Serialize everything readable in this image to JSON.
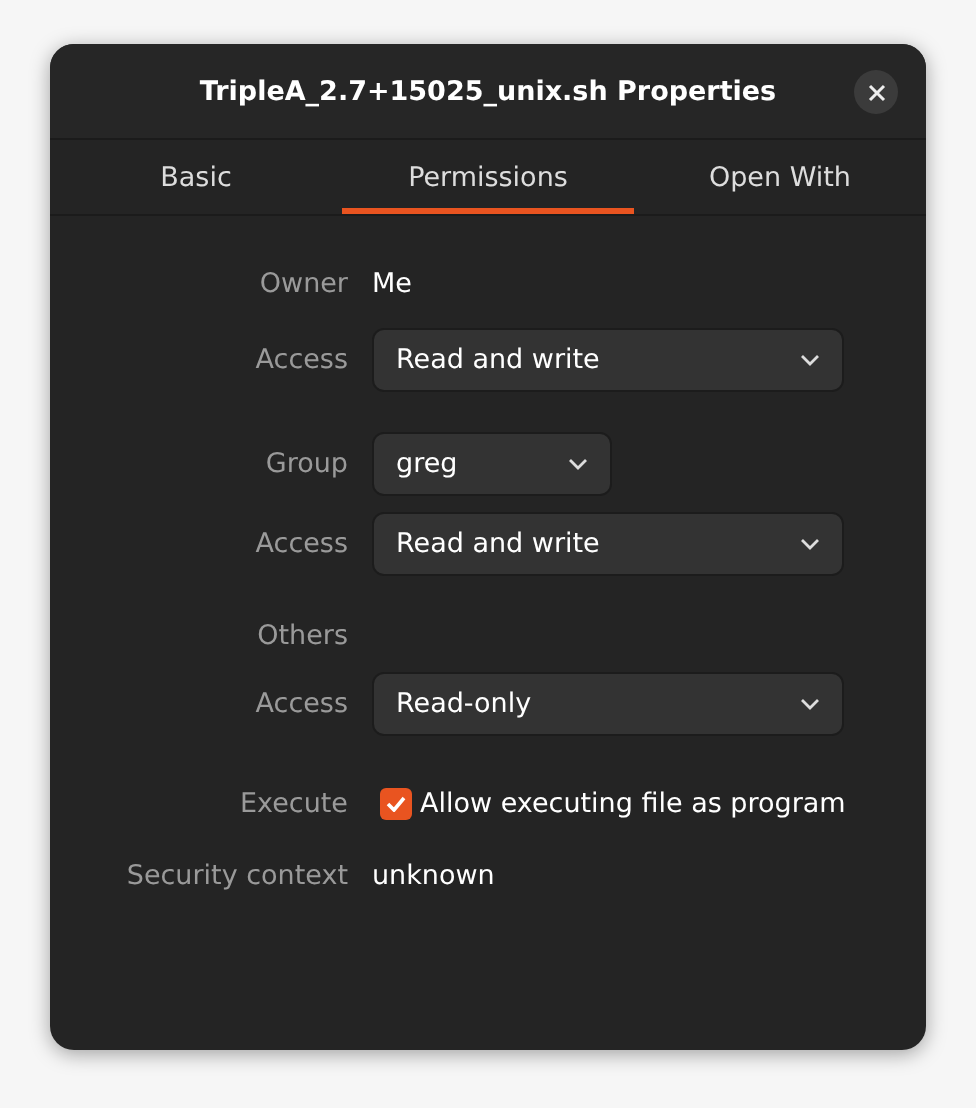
{
  "window": {
    "title": "TripleA_2.7+15025_unix.sh Properties"
  },
  "tabs": [
    {
      "label": "Basic",
      "selected": false
    },
    {
      "label": "Permissions",
      "selected": true
    },
    {
      "label": "Open With",
      "selected": false
    }
  ],
  "sections": [
    {
      "rows": [
        {
          "kind": "text",
          "label": "Owner",
          "value": "Me"
        },
        {
          "kind": "dropdown",
          "label": "Access",
          "value": "Read and write",
          "wide": true
        }
      ]
    },
    {
      "rows": [
        {
          "kind": "dropdown",
          "label": "Group",
          "value": "greg",
          "wide": false
        },
        {
          "kind": "dropdown",
          "label": "Access",
          "value": "Read and write",
          "wide": true
        }
      ]
    },
    {
      "rows": [
        {
          "kind": "heading",
          "label": "Others"
        },
        {
          "kind": "dropdown",
          "label": "Access",
          "value": "Read-only",
          "wide": true
        }
      ]
    },
    {
      "rows": [
        {
          "kind": "checkbox",
          "label": "Execute",
          "value": "Allow executing file as program",
          "checked": true
        },
        {
          "kind": "text",
          "label": "Security context",
          "value": "unknown"
        }
      ]
    }
  ]
}
